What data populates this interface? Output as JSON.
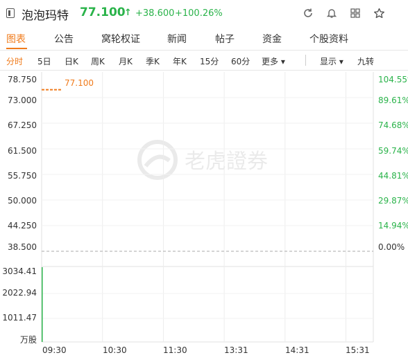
{
  "header": {
    "stock_name": "泡泡玛特",
    "price": "77.100",
    "arrow": "↑",
    "change": "+38.600",
    "change_pct": "+100.26%"
  },
  "header_icons": [
    "refresh-icon",
    "bell-icon",
    "grid-icon",
    "star-icon"
  ],
  "tabs": [
    "图表",
    "公告",
    "窝轮权证",
    "新闻",
    "帖子",
    "资金",
    "个股资料"
  ],
  "periods": [
    "分时",
    "5日",
    "日K",
    "周K",
    "月K",
    "季K",
    "年K",
    "15分",
    "60分",
    "更多 ▾",
    "显示 ▾",
    "九转"
  ],
  "watermark": "老虎證券",
  "chart_data": {
    "type": "line",
    "price_axis": [
      "78.750",
      "73.000",
      "67.250",
      "61.500",
      "55.750",
      "50.000",
      "44.250",
      "38.500"
    ],
    "pct_axis": [
      "104.55%",
      "89.61%",
      "74.68%",
      "59.74%",
      "44.81%",
      "29.87%",
      "14.94%",
      "0.00%"
    ],
    "volume_axis": [
      "3034.41",
      "2022.94",
      "1011.47",
      "万股"
    ],
    "time_axis": [
      "09:30",
      "10:30",
      "11:30",
      "13:31",
      "14:31",
      "15:31"
    ],
    "prev_close": 38.5,
    "last_price": 77.1,
    "last_price_label": "77.100",
    "ylim": [
      38.5,
      78.75
    ],
    "volume_ylim": [
      0,
      3034.41
    ],
    "volume_bars": [
      {
        "x": "09:30",
        "value": 3034.41
      }
    ],
    "colors": {
      "up": "#2ab34a",
      "price_line": "#f07a1a"
    }
  }
}
